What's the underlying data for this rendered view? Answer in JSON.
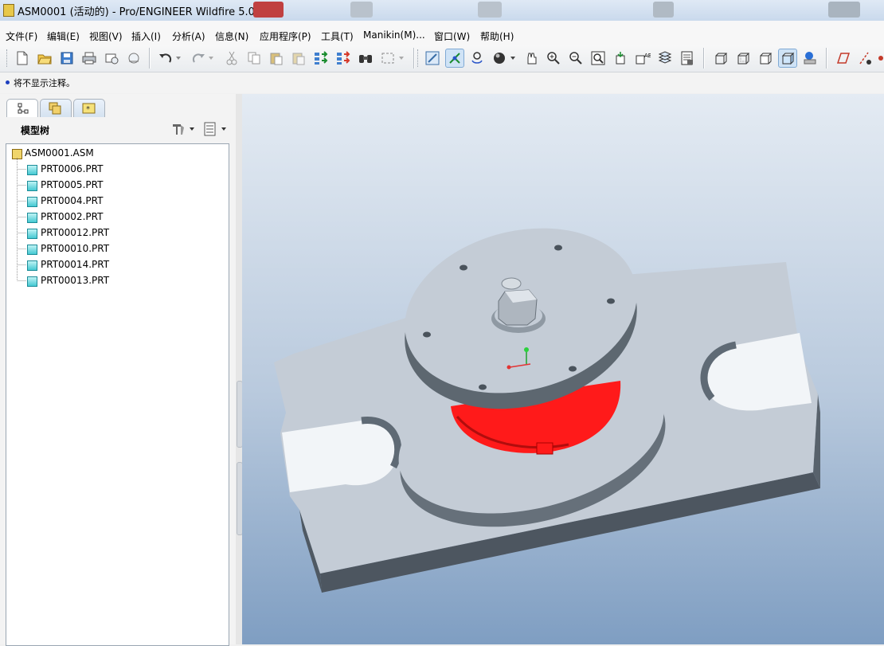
{
  "window": {
    "title": "ASM0001 (活动的) - Pro/ENGINEER Wildfire 5.0"
  },
  "menu": [
    "文件(F)",
    "编辑(E)",
    "视图(V)",
    "插入(I)",
    "分析(A)",
    "信息(N)",
    "应用程序(P)",
    "工具(T)",
    "Manikin(M)...",
    "窗口(W)",
    "帮助(H)"
  ],
  "message": {
    "text": "将不显示注释。"
  },
  "panel": {
    "tree_title": "模型树",
    "tabs": [
      "model-tree-tab",
      "folder-browser-tab",
      "favorites-tab"
    ]
  },
  "tree": {
    "root": "ASM0001.ASM",
    "items": [
      "PRT0006.PRT",
      "PRT0005.PRT",
      "PRT0004.PRT",
      "PRT0002.PRT",
      "PRT00012.PRT",
      "PRT00010.PRT",
      "PRT00014.PRT",
      "PRT00013.PRT"
    ]
  },
  "colors": {
    "model_gray": "#c4ccd6",
    "highlight_red": "#ff1a1a",
    "viewport_top": "#e4ebf3",
    "viewport_bottom": "#7f9ec2"
  }
}
